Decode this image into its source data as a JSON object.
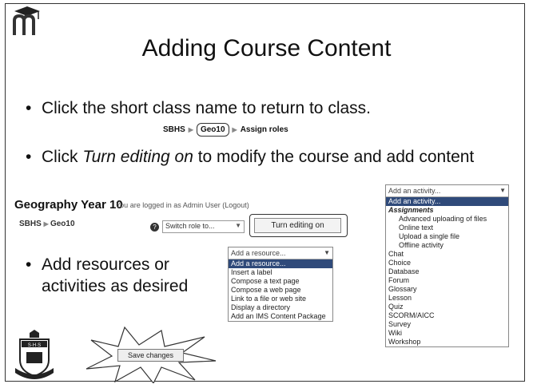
{
  "slide": {
    "title": "Adding Course Content",
    "bullets": [
      "Click the short class name to return to class.",
      "Click Turn editing on to modify the course and add content",
      "Add resources or activities as desired"
    ]
  },
  "breadcrumb1": {
    "site": "SBHS",
    "course": "Geo10",
    "page": "Assign roles"
  },
  "course_header": {
    "title": "Geography Year 10",
    "login_note": "You are logged in as Admin User (Logout)",
    "breadcrumb_site": "SBHS",
    "breadcrumb_course": "Geo10",
    "switch_role_placeholder": "Switch role to...",
    "turn_editing_label": "Turn editing on"
  },
  "resource_dropdown": {
    "header": "Add a resource...",
    "items": [
      "Add a resource...",
      "Insert a label",
      "Compose a text page",
      "Compose a web page",
      "Link to a file or web site",
      "Display a directory",
      "Add an IMS Content Package"
    ]
  },
  "activity_dropdown": {
    "header": "Add an activity...",
    "selected": "Add an activity...",
    "group": "Assignments",
    "group_items": [
      "Advanced uploading of files",
      "Online text",
      "Upload a single file",
      "Offline activity"
    ],
    "items": [
      "Chat",
      "Choice",
      "Database",
      "Forum",
      "Glossary",
      "Lesson",
      "Quiz",
      "SCORM/AICC",
      "Survey",
      "Wiki",
      "Workshop"
    ]
  },
  "save_button_label": "Save changes",
  "colors": {
    "highlight": "#2f4a7a"
  }
}
